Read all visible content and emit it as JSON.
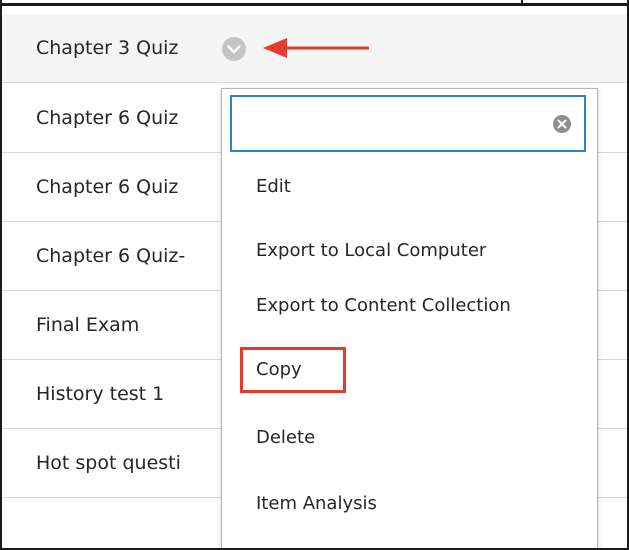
{
  "list": {
    "items": [
      {
        "label": "Chapter 3 Quiz"
      },
      {
        "label": "Chapter 6 Quiz"
      },
      {
        "label": "Chapter 6 Quiz"
      },
      {
        "label": "Chapter 6 Quiz-"
      },
      {
        "label": "Final Exam"
      },
      {
        "label": "History test 1"
      },
      {
        "label": "Hot spot questi"
      }
    ]
  },
  "context_menu": {
    "search": {
      "value": "",
      "placeholder": ""
    },
    "items": [
      {
        "label": "Edit"
      },
      {
        "label": "Export to Local Computer"
      },
      {
        "label": "Export to Content Collection"
      },
      {
        "label": "Copy"
      },
      {
        "label": "Delete"
      },
      {
        "label": "Item Analysis"
      }
    ],
    "highlighted_item": "Copy"
  },
  "colors": {
    "search_focus_border": "#2a84c6",
    "annotation_red": "#e53b2c",
    "chevron_gray": "#c4c4c4",
    "first_row_background": "#f5f5f5"
  },
  "icons": {
    "row_menu_toggle": "chevron-down-icon",
    "annotation": "arrow-left-icon",
    "search_clear": "clear-icon"
  }
}
